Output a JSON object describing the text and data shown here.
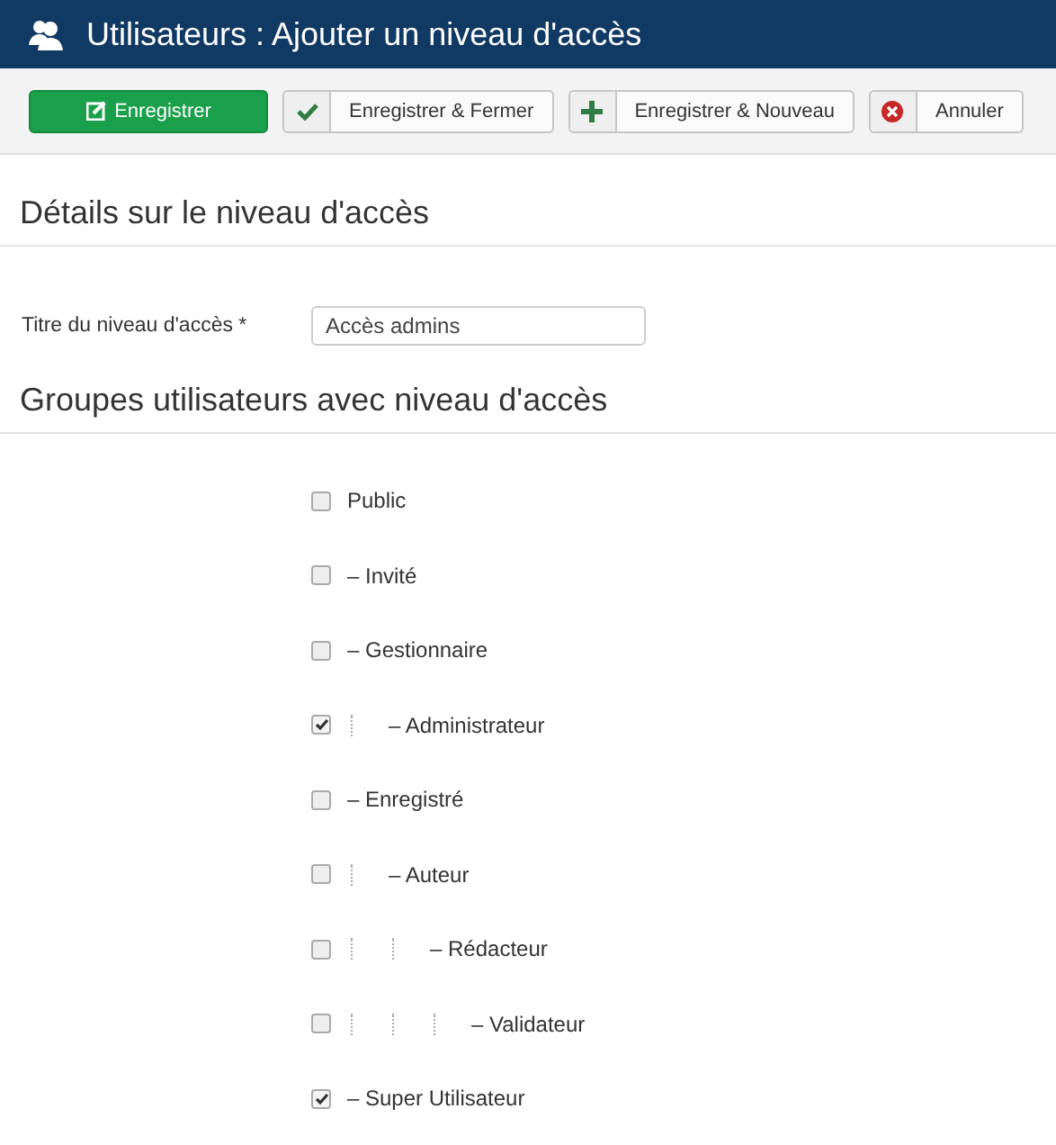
{
  "header": {
    "title": "Utilisateurs : Ajouter un niveau d'accès"
  },
  "toolbar": [
    {
      "kind": "save",
      "label": "Enregistrer"
    },
    {
      "kind": "check",
      "label": "Enregistrer & Fermer"
    },
    {
      "kind": "plus",
      "label": "Enregistrer & Nouveau"
    },
    {
      "kind": "cancel",
      "label": "Annuler"
    }
  ],
  "details": {
    "heading": "Détails sur le niveau d'accès",
    "field_label": "Titre du niveau d'accès *",
    "field_value": "Accès admins"
  },
  "groups": {
    "heading": "Groupes utilisateurs avec niveau d'accès",
    "items": [
      {
        "label": "Public",
        "checked": false,
        "children": [
          {
            "label": "– Invité",
            "checked": false
          },
          {
            "label": "– Gestionnaire",
            "checked": false,
            "children": [
              {
                "label": "– Administrateur",
                "checked": true
              }
            ]
          },
          {
            "label": "– Enregistré",
            "checked": false,
            "children": [
              {
                "label": "– Auteur",
                "checked": false,
                "children": [
                  {
                    "label": "– Rédacteur",
                    "checked": false,
                    "children": [
                      {
                        "label": "– Validateur",
                        "checked": false
                      }
                    ]
                  }
                ]
              }
            ]
          },
          {
            "label": "– Super Utilisateur",
            "checked": true
          }
        ]
      }
    ]
  }
}
